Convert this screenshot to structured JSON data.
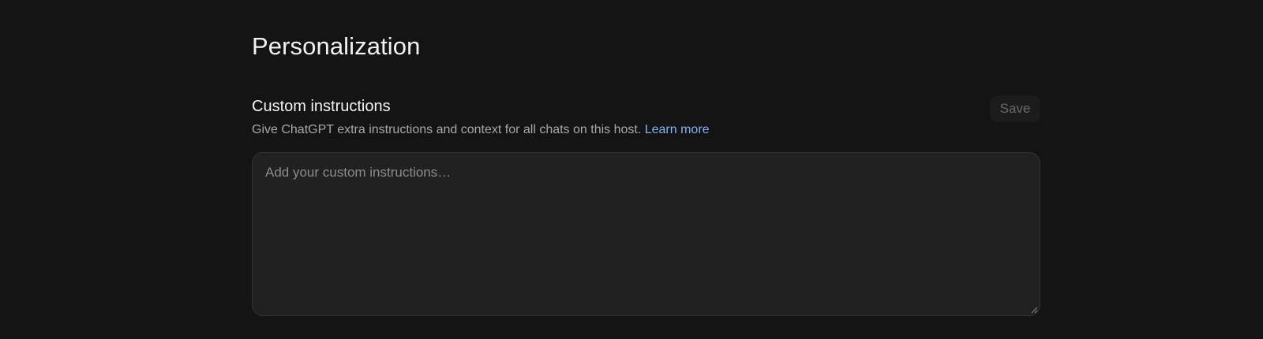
{
  "page": {
    "title": "Personalization"
  },
  "custom_instructions": {
    "title": "Custom instructions",
    "description": "Give ChatGPT extra instructions and context for all chats on this host.",
    "learn_more_label": "Learn more",
    "save_label": "Save",
    "input": {
      "value": "",
      "placeholder": "Add your custom instructions…"
    }
  },
  "colors": {
    "background": "#141414",
    "textarea_background": "#212121",
    "link": "#7fb4f0",
    "save_disabled_text": "#6a6a6a"
  },
  "icons": {
    "resize_handle": "resize-grip-icon"
  }
}
